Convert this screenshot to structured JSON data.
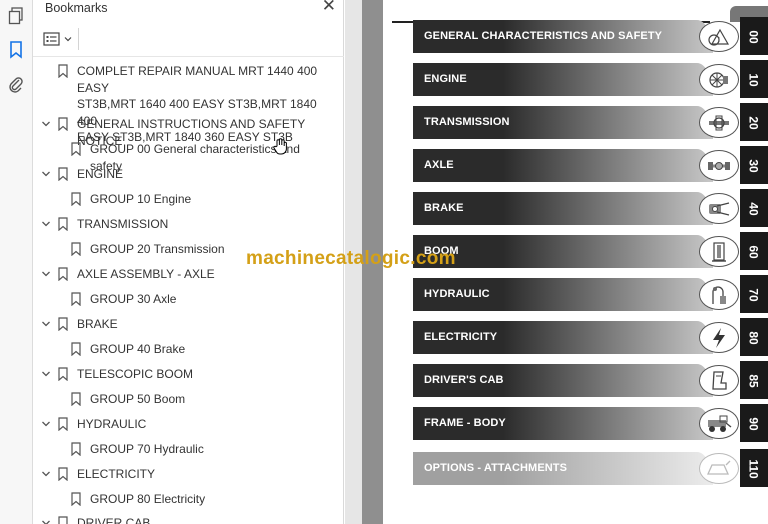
{
  "rail": {
    "items": [
      {
        "name": "pages-thumbnails-icon"
      },
      {
        "name": "bookmark-icon"
      },
      {
        "name": "attachment-icon"
      }
    ]
  },
  "bookmarks_panel": {
    "title": "Bookmarks",
    "close_glyph": "✕",
    "items": [
      {
        "label": "COMPLET REPAIR MANUAL MRT 1440 400 EASY\nST3B,MRT 1640 400 EASY ST3B,MRT 1840 400\nEASY ST3B,MRT 1840  360 EASY ST3B",
        "level": 0,
        "expandable": false
      },
      {
        "label": "GENERAL INSTRUCTIONS AND SAFETY NOTICE",
        "level": 0,
        "expandable": true
      },
      {
        "label": "GROUP 00 General characteristics and safety",
        "level": 1,
        "expandable": false
      },
      {
        "label": "ENGINE",
        "level": 0,
        "expandable": true
      },
      {
        "label": "GROUP 10 Engine",
        "level": 1,
        "expandable": false
      },
      {
        "label": "TRANSMISSION",
        "level": 0,
        "expandable": true
      },
      {
        "label": "GROUP 20 Transmission",
        "level": 1,
        "expandable": false
      },
      {
        "label": "AXLE ASSEMBLY - AXLE",
        "level": 0,
        "expandable": true
      },
      {
        "label": "GROUP 30 Axle",
        "level": 1,
        "expandable": false
      },
      {
        "label": "BRAKE",
        "level": 0,
        "expandable": true
      },
      {
        "label": "GROUP 40 Brake",
        "level": 1,
        "expandable": false
      },
      {
        "label": "TELESCOPIC BOOM",
        "level": 0,
        "expandable": true
      },
      {
        "label": "GROUP 50 Boom",
        "level": 1,
        "expandable": false
      },
      {
        "label": "HYDRAULIC",
        "level": 0,
        "expandable": true
      },
      {
        "label": "GROUP 70 Hydraulic",
        "level": 1,
        "expandable": false
      },
      {
        "label": "ELECTRICITY",
        "level": 0,
        "expandable": true
      },
      {
        "label": "GROUP 80 Electricity",
        "level": 1,
        "expandable": false
      },
      {
        "label": "DRIVER CAB",
        "level": 0,
        "expandable": true
      }
    ]
  },
  "document": {
    "watermark": "machinecatalogic.com",
    "tabs": [
      {
        "label": "GENERAL CHARACTERISTICS AND SAFETY",
        "number": "00",
        "icon": "warning-icon",
        "shade": "dark"
      },
      {
        "label": "ENGINE",
        "number": "10",
        "icon": "engine-icon",
        "shade": "dark"
      },
      {
        "label": "TRANSMISSION",
        "number": "20",
        "icon": "transmission-icon",
        "shade": "dark"
      },
      {
        "label": "AXLE",
        "number": "30",
        "icon": "axle-icon",
        "shade": "dark"
      },
      {
        "label": "BRAKE",
        "number": "40",
        "icon": "brake-icon",
        "shade": "dark"
      },
      {
        "label": "BOOM",
        "number": "60",
        "icon": "boom-icon",
        "shade": "dark"
      },
      {
        "label": "HYDRAULIC",
        "number": "70",
        "icon": "hydraulic-icon",
        "shade": "dark"
      },
      {
        "label": "ELECTRICITY",
        "number": "80",
        "icon": "lightning-icon",
        "shade": "dark"
      },
      {
        "label": "DRIVER'S CAB",
        "number": "85",
        "icon": "seat-icon",
        "shade": "dark"
      },
      {
        "label": "FRAME - BODY",
        "number": "90",
        "icon": "vehicle-icon",
        "shade": "dark"
      },
      {
        "label": "OPTIONS - ATTACHMENTS",
        "number": "110",
        "icon": "attachment-bucket-icon",
        "shade": "light"
      }
    ]
  },
  "colors": {
    "tab_dark_start": "#2b2b2b",
    "tab_dark_end": "#c8c8c8",
    "tab_light_start": "#a0a0a0",
    "tab_light_end": "#ececec",
    "watermark": "#d4a017",
    "accent": "#1473e6"
  }
}
